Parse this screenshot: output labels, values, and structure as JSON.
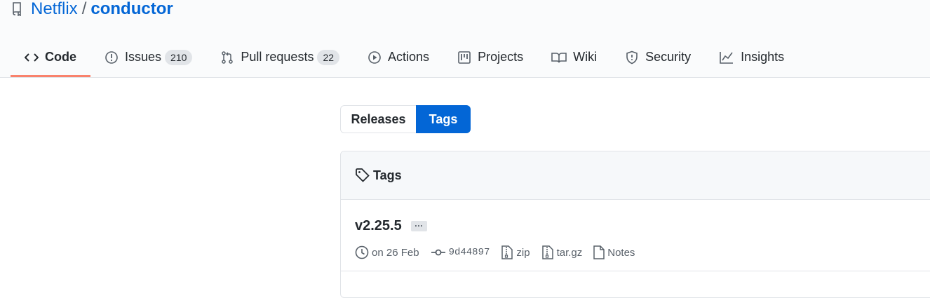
{
  "repo": {
    "owner": "Netflix",
    "separator": "/",
    "name": "conductor"
  },
  "nav": {
    "code": "Code",
    "issues": "Issues",
    "issues_count": "210",
    "pulls": "Pull requests",
    "pulls_count": "22",
    "actions": "Actions",
    "projects": "Projects",
    "wiki": "Wiki",
    "security": "Security",
    "insights": "Insights"
  },
  "subnav": {
    "releases": "Releases",
    "tags": "Tags"
  },
  "tags_box": {
    "header": "Tags",
    "items": [
      {
        "name": "v2.25.5",
        "more": "···",
        "date": "on 26 Feb",
        "sha": "9d44897",
        "zip": "zip",
        "targz": "tar.gz",
        "notes": "Notes"
      }
    ]
  },
  "colors": {
    "link": "#0366d6",
    "selected_underline": "#f9826c",
    "active_tab": "#0366d6"
  },
  "icons": [
    "repo-icon",
    "code-icon",
    "issue-icon",
    "pull-request-icon",
    "play-icon",
    "project-icon",
    "book-icon",
    "shield-icon",
    "graph-icon",
    "tag-icon",
    "clock-icon",
    "commit-icon",
    "file-zip-icon",
    "file-icon"
  ]
}
